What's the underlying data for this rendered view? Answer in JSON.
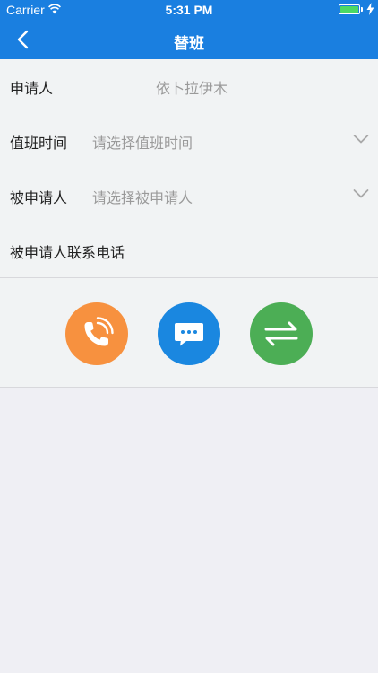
{
  "status_bar": {
    "carrier": "Carrier",
    "time": "5:31 PM"
  },
  "nav": {
    "title": "替班",
    "back_icon": "chevron-left-icon"
  },
  "form": {
    "applicant": {
      "label": "申请人",
      "value": "依卜拉伊木"
    },
    "duty_time": {
      "label": "值班时间",
      "placeholder": "请选择值班时间"
    },
    "substitute": {
      "label": "被申请人",
      "placeholder": "请选择被申请人"
    },
    "substitute_phone": {
      "label": "被申请人联系电话",
      "value": ""
    }
  },
  "actions": [
    {
      "icon": "phone-icon",
      "color": "#f7913f"
    },
    {
      "icon": "message-icon",
      "color": "#1a87e0"
    },
    {
      "icon": "swap-icon",
      "color": "#4cae55"
    }
  ],
  "colors": {
    "accent": "#1a7fe0",
    "background": "#efeff4"
  }
}
